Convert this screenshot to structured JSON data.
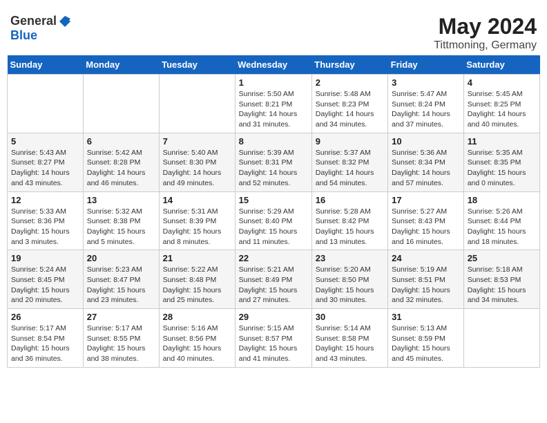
{
  "header": {
    "logo_general": "General",
    "logo_blue": "Blue",
    "month_year": "May 2024",
    "location": "Tittmoning, Germany"
  },
  "weekdays": [
    "Sunday",
    "Monday",
    "Tuesday",
    "Wednesday",
    "Thursday",
    "Friday",
    "Saturday"
  ],
  "weeks": [
    [
      {
        "day": "",
        "info": ""
      },
      {
        "day": "",
        "info": ""
      },
      {
        "day": "",
        "info": ""
      },
      {
        "day": "1",
        "info": "Sunrise: 5:50 AM\nSunset: 8:21 PM\nDaylight: 14 hours\nand 31 minutes."
      },
      {
        "day": "2",
        "info": "Sunrise: 5:48 AM\nSunset: 8:23 PM\nDaylight: 14 hours\nand 34 minutes."
      },
      {
        "day": "3",
        "info": "Sunrise: 5:47 AM\nSunset: 8:24 PM\nDaylight: 14 hours\nand 37 minutes."
      },
      {
        "day": "4",
        "info": "Sunrise: 5:45 AM\nSunset: 8:25 PM\nDaylight: 14 hours\nand 40 minutes."
      }
    ],
    [
      {
        "day": "5",
        "info": "Sunrise: 5:43 AM\nSunset: 8:27 PM\nDaylight: 14 hours\nand 43 minutes."
      },
      {
        "day": "6",
        "info": "Sunrise: 5:42 AM\nSunset: 8:28 PM\nDaylight: 14 hours\nand 46 minutes."
      },
      {
        "day": "7",
        "info": "Sunrise: 5:40 AM\nSunset: 8:30 PM\nDaylight: 14 hours\nand 49 minutes."
      },
      {
        "day": "8",
        "info": "Sunrise: 5:39 AM\nSunset: 8:31 PM\nDaylight: 14 hours\nand 52 minutes."
      },
      {
        "day": "9",
        "info": "Sunrise: 5:37 AM\nSunset: 8:32 PM\nDaylight: 14 hours\nand 54 minutes."
      },
      {
        "day": "10",
        "info": "Sunrise: 5:36 AM\nSunset: 8:34 PM\nDaylight: 14 hours\nand 57 minutes."
      },
      {
        "day": "11",
        "info": "Sunrise: 5:35 AM\nSunset: 8:35 PM\nDaylight: 15 hours\nand 0 minutes."
      }
    ],
    [
      {
        "day": "12",
        "info": "Sunrise: 5:33 AM\nSunset: 8:36 PM\nDaylight: 15 hours\nand 3 minutes."
      },
      {
        "day": "13",
        "info": "Sunrise: 5:32 AM\nSunset: 8:38 PM\nDaylight: 15 hours\nand 5 minutes."
      },
      {
        "day": "14",
        "info": "Sunrise: 5:31 AM\nSunset: 8:39 PM\nDaylight: 15 hours\nand 8 minutes."
      },
      {
        "day": "15",
        "info": "Sunrise: 5:29 AM\nSunset: 8:40 PM\nDaylight: 15 hours\nand 11 minutes."
      },
      {
        "day": "16",
        "info": "Sunrise: 5:28 AM\nSunset: 8:42 PM\nDaylight: 15 hours\nand 13 minutes."
      },
      {
        "day": "17",
        "info": "Sunrise: 5:27 AM\nSunset: 8:43 PM\nDaylight: 15 hours\nand 16 minutes."
      },
      {
        "day": "18",
        "info": "Sunrise: 5:26 AM\nSunset: 8:44 PM\nDaylight: 15 hours\nand 18 minutes."
      }
    ],
    [
      {
        "day": "19",
        "info": "Sunrise: 5:24 AM\nSunset: 8:45 PM\nDaylight: 15 hours\nand 20 minutes."
      },
      {
        "day": "20",
        "info": "Sunrise: 5:23 AM\nSunset: 8:47 PM\nDaylight: 15 hours\nand 23 minutes."
      },
      {
        "day": "21",
        "info": "Sunrise: 5:22 AM\nSunset: 8:48 PM\nDaylight: 15 hours\nand 25 minutes."
      },
      {
        "day": "22",
        "info": "Sunrise: 5:21 AM\nSunset: 8:49 PM\nDaylight: 15 hours\nand 27 minutes."
      },
      {
        "day": "23",
        "info": "Sunrise: 5:20 AM\nSunset: 8:50 PM\nDaylight: 15 hours\nand 30 minutes."
      },
      {
        "day": "24",
        "info": "Sunrise: 5:19 AM\nSunset: 8:51 PM\nDaylight: 15 hours\nand 32 minutes."
      },
      {
        "day": "25",
        "info": "Sunrise: 5:18 AM\nSunset: 8:53 PM\nDaylight: 15 hours\nand 34 minutes."
      }
    ],
    [
      {
        "day": "26",
        "info": "Sunrise: 5:17 AM\nSunset: 8:54 PM\nDaylight: 15 hours\nand 36 minutes."
      },
      {
        "day": "27",
        "info": "Sunrise: 5:17 AM\nSunset: 8:55 PM\nDaylight: 15 hours\nand 38 minutes."
      },
      {
        "day": "28",
        "info": "Sunrise: 5:16 AM\nSunset: 8:56 PM\nDaylight: 15 hours\nand 40 minutes."
      },
      {
        "day": "29",
        "info": "Sunrise: 5:15 AM\nSunset: 8:57 PM\nDaylight: 15 hours\nand 41 minutes."
      },
      {
        "day": "30",
        "info": "Sunrise: 5:14 AM\nSunset: 8:58 PM\nDaylight: 15 hours\nand 43 minutes."
      },
      {
        "day": "31",
        "info": "Sunrise: 5:13 AM\nSunset: 8:59 PM\nDaylight: 15 hours\nand 45 minutes."
      },
      {
        "day": "",
        "info": ""
      }
    ]
  ]
}
